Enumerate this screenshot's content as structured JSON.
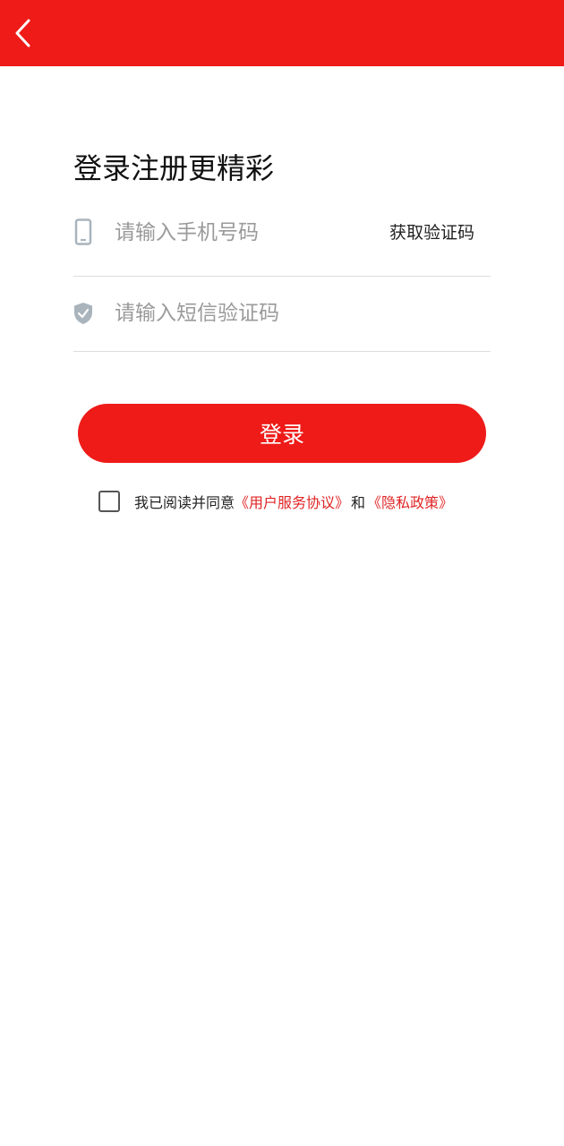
{
  "header": {
    "back_icon": "chevron-left-icon",
    "background_color": "#EE1B18"
  },
  "title": "登录注册更精彩",
  "phone_field": {
    "icon": "phone-icon",
    "placeholder": "请输入手机号码",
    "value": "",
    "get_code_label": "获取验证码"
  },
  "code_field": {
    "icon": "shield-check-icon",
    "placeholder": "请输入短信验证码",
    "value": ""
  },
  "login_button": {
    "label": "登录",
    "color": "#EE1B18"
  },
  "agreement": {
    "checked": false,
    "prefix": "我已阅读并同意",
    "user_agreement": "《用户服务协议》",
    "conjunction": "和",
    "privacy_policy": "《隐私政策》",
    "link_color": "#E02424"
  }
}
